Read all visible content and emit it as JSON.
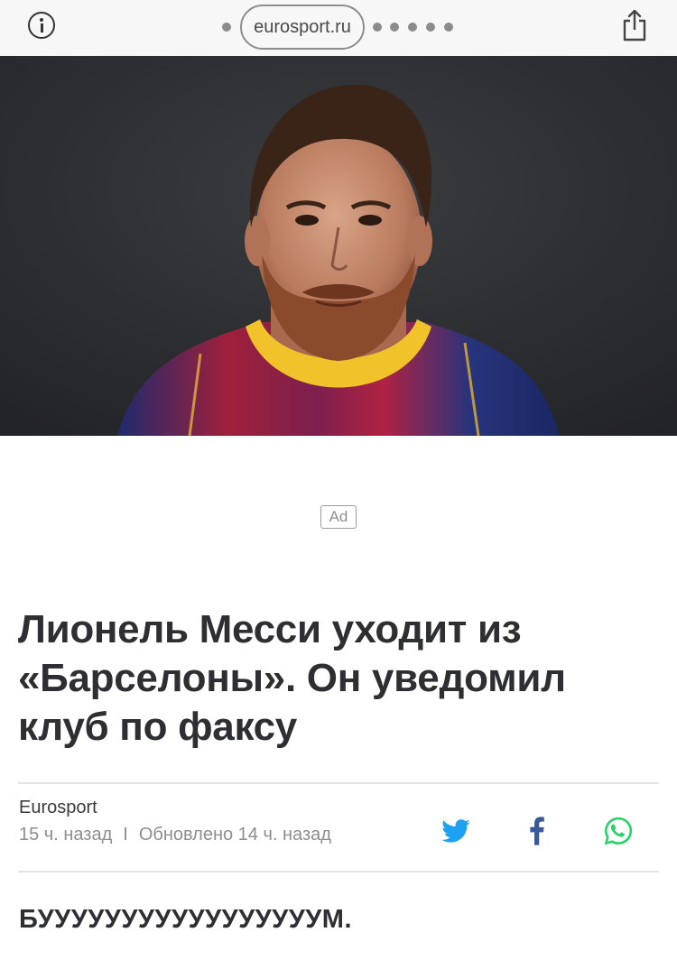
{
  "browser": {
    "url": "eurosport.ru"
  },
  "ad": {
    "label": "Ad"
  },
  "article": {
    "headline_lines": [
      "Лионель Месси уходит из",
      "«Барселоны». Он уведомил",
      "клуб по факсу"
    ],
    "source": "Eurosport",
    "published": "15 ч. назад",
    "separator": "I",
    "updated": "Обновлено 14 ч. назад",
    "lead": "БУУУУУУУУУУУУУУУУУМ."
  },
  "colors": {
    "twitter": "#1da1f2",
    "facebook": "#3b5998",
    "whatsapp": "#25d366"
  },
  "icons": {
    "info": "info-icon",
    "share": "share-icon",
    "twitter": "twitter-icon",
    "facebook": "facebook-icon",
    "whatsapp": "whatsapp-icon"
  }
}
